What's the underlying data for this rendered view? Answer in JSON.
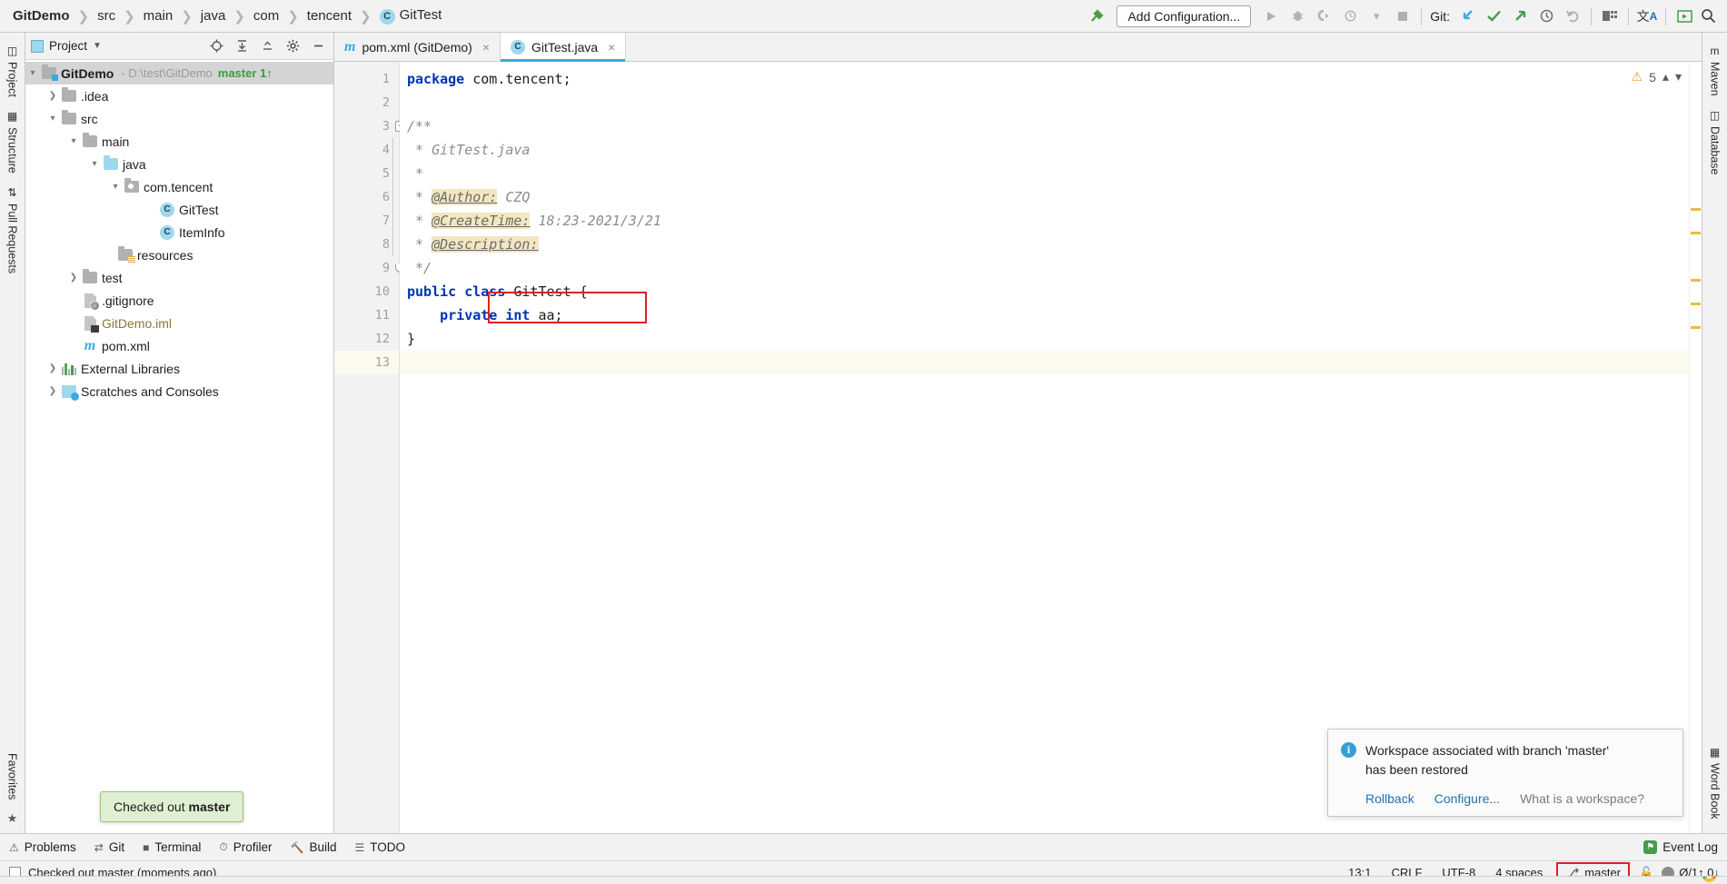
{
  "breadcrumb": {
    "items": [
      "GitDemo",
      "src",
      "main",
      "java",
      "com",
      "tencent"
    ],
    "file": "GitTest",
    "file_icon": "C"
  },
  "toolbar": {
    "build_icon": "hammer-icon",
    "add_configuration": "Add Configuration...",
    "git_label": "Git:",
    "icons": [
      "run-icon",
      "debug-icon",
      "run-coverage-icon",
      "profile-icon",
      "dropdown-icon",
      "stop-icon",
      "git-update-icon",
      "git-commit-icon",
      "git-push-icon",
      "git-history-icon",
      "git-rollback-icon",
      "project-structure-icon",
      "translate-icon",
      "presentation-icon",
      "search-everywhere-icon"
    ]
  },
  "left_rail": {
    "items": [
      "Project",
      "Structure",
      "Pull Requests"
    ],
    "bottom": "Favorites"
  },
  "right_rail": {
    "items": [
      "Maven",
      "Database",
      "Word Book"
    ]
  },
  "project_panel": {
    "title": "Project",
    "dropdown": "chevron-down-icon",
    "buttons": [
      "locate-icon",
      "expand-all-icon",
      "collapse-all-icon",
      "settings-icon",
      "hide-icon"
    ],
    "tree": [
      {
        "label": "GitDemo",
        "path": "- D:\\test\\GitDemo",
        "branch": "master 1↑",
        "icon": "folder-module",
        "indent": 0,
        "arrow": "down",
        "bold": true,
        "selected": true
      },
      {
        "label": ".idea",
        "icon": "folder",
        "indent": 1,
        "arrow": "right"
      },
      {
        "label": "src",
        "icon": "folder",
        "indent": 1,
        "arrow": "down"
      },
      {
        "label": "main",
        "icon": "folder",
        "indent": 2,
        "arrow": "down"
      },
      {
        "label": "java",
        "icon": "folder-source",
        "indent": 3,
        "arrow": "down"
      },
      {
        "label": "com.tencent",
        "icon": "folder-package",
        "indent": 4,
        "arrow": "down"
      },
      {
        "label": "GitTest",
        "icon": "class",
        "indent": 5,
        "arrow": "none"
      },
      {
        "label": "ItemInfo",
        "icon": "class",
        "indent": 5,
        "arrow": "none"
      },
      {
        "label": "resources",
        "icon": "folder-resources",
        "indent": 3,
        "arrow": "none"
      },
      {
        "label": "test",
        "icon": "folder",
        "indent": 2,
        "arrow": "right"
      },
      {
        "label": ".gitignore",
        "icon": "file-ignored",
        "indent": 1,
        "arrow": "none"
      },
      {
        "label": "GitDemo.iml",
        "icon": "file-module",
        "indent": 1,
        "arrow": "none",
        "olive": true
      },
      {
        "label": "pom.xml",
        "icon": "maven",
        "indent": 1,
        "arrow": "none"
      },
      {
        "label": "External Libraries",
        "icon": "libraries",
        "indent": 0,
        "arrow": "right"
      },
      {
        "label": "Scratches and Consoles",
        "icon": "scratches",
        "indent": 0,
        "arrow": "right"
      }
    ]
  },
  "checkout_tooltip": {
    "prefix": "Checked out ",
    "branch": "master"
  },
  "tabs": [
    {
      "label": "pom.xml (GitDemo)",
      "icon": "maven-icon",
      "active": false,
      "close": "×"
    },
    {
      "label": "GitTest.java",
      "icon": "class-icon",
      "active": true,
      "close": "×"
    }
  ],
  "inspection": {
    "count": "5",
    "icon": "warning-triangle-icon",
    "up": "chevron-up-icon",
    "down": "chevron-down-icon"
  },
  "editor": {
    "lines": [
      {
        "n": "1",
        "tokens": [
          {
            "t": "kw",
            "v": "package"
          },
          {
            "t": "plain",
            "v": " com.tencent;"
          }
        ]
      },
      {
        "n": "2",
        "tokens": []
      },
      {
        "n": "3",
        "fold": "minus",
        "tokens": [
          {
            "t": "cm",
            "v": "/**"
          }
        ]
      },
      {
        "n": "4",
        "tokens": [
          {
            "t": "cm",
            "v": " * GitTest.java"
          }
        ]
      },
      {
        "n": "5",
        "tokens": [
          {
            "t": "cm",
            "v": " *"
          }
        ]
      },
      {
        "n": "6",
        "tokens": [
          {
            "t": "cm",
            "v": " * "
          },
          {
            "t": "cm-tag",
            "v": "@Author:"
          },
          {
            "t": "cm",
            "v": " CZQ"
          }
        ]
      },
      {
        "n": "7",
        "tokens": [
          {
            "t": "cm",
            "v": " * "
          },
          {
            "t": "cm-tag",
            "v": "@CreateTime:"
          },
          {
            "t": "cm",
            "v": " 18:23-2021/3/21"
          }
        ]
      },
      {
        "n": "8",
        "tokens": [
          {
            "t": "cm",
            "v": " * "
          },
          {
            "t": "cm-tag",
            "v": "@Description:"
          }
        ]
      },
      {
        "n": "9",
        "fold": "end",
        "tokens": [
          {
            "t": "cm",
            "v": " */"
          }
        ]
      },
      {
        "n": "10",
        "tokens": [
          {
            "t": "kw",
            "v": "public class"
          },
          {
            "t": "cls",
            "v": " GitTest {"
          }
        ]
      },
      {
        "n": "11",
        "tokens": [
          {
            "t": "plain",
            "v": "    "
          },
          {
            "t": "kw",
            "v": "private int"
          },
          {
            "t": "plain",
            "v": " aa;"
          }
        ]
      },
      {
        "n": "12",
        "tokens": [
          {
            "t": "plain",
            "v": "}"
          }
        ]
      },
      {
        "n": "13",
        "current": true,
        "tokens": []
      }
    ],
    "markers": [
      229,
      255,
      307,
      333,
      359
    ]
  },
  "annotation_box": {
    "color": "#e02020"
  },
  "balloon": {
    "icon": "info-icon",
    "line1": "Workspace associated with branch 'master'",
    "line2": "has been restored",
    "actions": [
      {
        "label": "Rollback",
        "muted": false
      },
      {
        "label": "Configure...",
        "muted": false
      },
      {
        "label": "What is a workspace?",
        "muted": true
      }
    ]
  },
  "bottom_toolwindows": [
    {
      "label": "Problems",
      "icon": "problems-icon"
    },
    {
      "label": "Git",
      "icon": "git-icon"
    },
    {
      "label": "Terminal",
      "icon": "terminal-icon"
    },
    {
      "label": "Profiler",
      "icon": "profiler-icon"
    },
    {
      "label": "Build",
      "icon": "build-icon"
    },
    {
      "label": "TODO",
      "icon": "todo-icon"
    }
  ],
  "event_log": {
    "label": "Event Log",
    "icon": "event-log-icon"
  },
  "statusbar": {
    "message": "Checked out master (moments ago)",
    "caret": "13:1",
    "line_separator": "CRLF",
    "encoding": "UTF-8",
    "indent": "4 spaces",
    "branch": "master",
    "branch_icon": "branch-icon",
    "lock_icon": "lock-icon",
    "memory": "Ø/1↑ 0↓"
  }
}
